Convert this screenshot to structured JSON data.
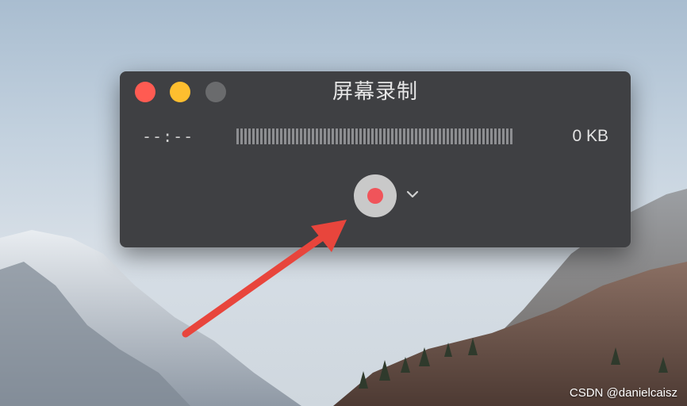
{
  "window": {
    "title": "屏幕录制",
    "elapsed_time": "--:--",
    "file_size": "0 KB"
  },
  "controls": {
    "record_icon": "record-icon",
    "options_icon": "chevron-down-icon"
  },
  "colors": {
    "window_bg": "#3f4043",
    "close": "#ff5b52",
    "minimize": "#febe2f",
    "zoom_disabled": "#6a6b6d",
    "record_dot": "#f0545a",
    "annotation_arrow": "#e8453c"
  },
  "watermark": "CSDN @danielcaisz"
}
